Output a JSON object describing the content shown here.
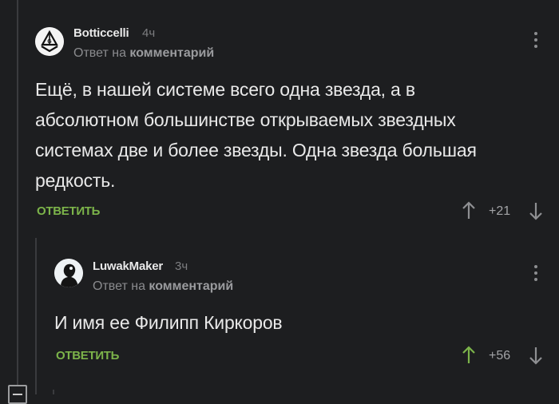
{
  "comments": [
    {
      "author": "Botticcelli",
      "time": "4ч",
      "reply_prefix": "Ответ на",
      "reply_link": "комментарий",
      "text_lines": [
        "Ещё, в нашей системе всего одна звезда, а в",
        "абсолютном большинстве открываемых звездных",
        "системах две и более звезды. Одна звезда большая",
        "редкость."
      ],
      "reply_label": "ОТВЕТИТЬ",
      "rating": "+21",
      "upvoted": false
    },
    {
      "author": "LuwakMaker",
      "time": "3ч",
      "reply_prefix": "Ответ на",
      "reply_link": "комментарий",
      "text_lines": [
        "И имя ее Филипп Киркоров"
      ],
      "reply_label": "ОТВЕТИТЬ",
      "rating": "+56",
      "upvoted": true
    }
  ],
  "colors": {
    "accent": "#7cb44a",
    "background": "#1d1e20",
    "muted": "#8a8b8e"
  },
  "icons": [
    "mason-emblem-avatar",
    "silhouette-avatar",
    "kebab-icon",
    "arrow-up-icon",
    "arrow-down-icon",
    "collapse-icon"
  ]
}
